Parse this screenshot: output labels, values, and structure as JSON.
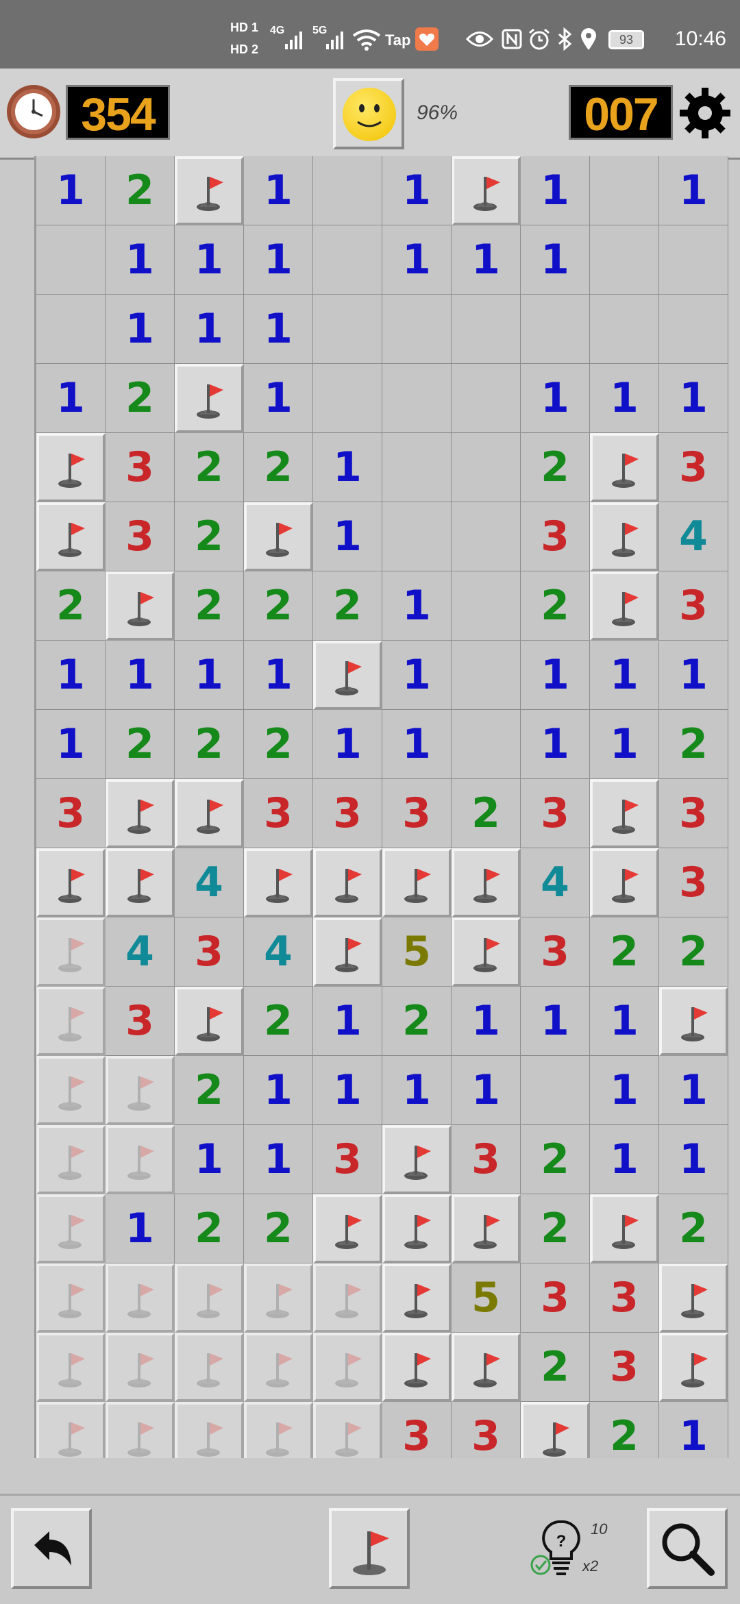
{
  "status_bar": {
    "left_icons": [
      "HD 1",
      "HD 2",
      "4G",
      "5G",
      "Tap"
    ],
    "battery": "93",
    "time": "10:46"
  },
  "header": {
    "timer": "354",
    "win_rate": "96%",
    "mines_left": "007"
  },
  "legend": {
    "cell_codes": {
      "0": "empty",
      "1-8": "revealed number",
      "F": "flag",
      "f": "faded flag"
    }
  },
  "board": [
    [
      "1",
      "2",
      "F",
      "1",
      "0",
      "1",
      "F",
      "1",
      "0",
      "1"
    ],
    [
      "0",
      "1",
      "1",
      "1",
      "0",
      "1",
      "1",
      "1",
      "0",
      "0"
    ],
    [
      "0",
      "1",
      "1",
      "1",
      "0",
      "0",
      "0",
      "0",
      "0",
      "0"
    ],
    [
      "1",
      "2",
      "F",
      "1",
      "0",
      "0",
      "0",
      "1",
      "1",
      "1"
    ],
    [
      "F",
      "3",
      "2",
      "2",
      "1",
      "0",
      "0",
      "2",
      "F",
      "3"
    ],
    [
      "F",
      "3",
      "2",
      "F",
      "1",
      "0",
      "0",
      "3",
      "F",
      "4"
    ],
    [
      "2",
      "F",
      "2",
      "2",
      "2",
      "1",
      "0",
      "2",
      "F",
      "3"
    ],
    [
      "1",
      "1",
      "1",
      "1",
      "F",
      "1",
      "0",
      "1",
      "1",
      "1"
    ],
    [
      "1",
      "2",
      "2",
      "2",
      "1",
      "1",
      "0",
      "1",
      "1",
      "2"
    ],
    [
      "3",
      "F",
      "F",
      "3",
      "3",
      "3",
      "2",
      "3",
      "F",
      "3"
    ],
    [
      "F",
      "F",
      "4",
      "F",
      "F",
      "F",
      "F",
      "4",
      "F",
      "3"
    ],
    [
      "f",
      "4",
      "3",
      "4",
      "F",
      "5",
      "F",
      "3",
      "2",
      "2"
    ],
    [
      "f",
      "3",
      "F",
      "2",
      "1",
      "2",
      "1",
      "1",
      "1",
      "F"
    ],
    [
      "f",
      "f",
      "2",
      "1",
      "1",
      "1",
      "1",
      "0",
      "1",
      "1"
    ],
    [
      "f",
      "f",
      "1",
      "1",
      "3",
      "F",
      "3",
      "2",
      "1",
      "1"
    ],
    [
      "f",
      "1",
      "2",
      "2",
      "F",
      "F",
      "F",
      "2",
      "F",
      "2"
    ],
    [
      "f",
      "f",
      "f",
      "f",
      "f",
      "F",
      "5",
      "3",
      "3",
      "F"
    ],
    [
      "f",
      "f",
      "f",
      "f",
      "f",
      "F",
      "F",
      "2",
      "3",
      "F"
    ],
    [
      "f",
      "f",
      "f",
      "f",
      "f",
      "3",
      "3",
      "F",
      "2",
      "1"
    ]
  ],
  "bottom_bar": {
    "hints_remaining": "10",
    "hint_multiplier": "x2"
  },
  "colors": {
    "n1": "#1010c8",
    "n2": "#15891a",
    "n3": "#c9262a",
    "n4": "#118a98",
    "n5": "#7a7a00",
    "lcd_digits": "#e8a21c"
  }
}
